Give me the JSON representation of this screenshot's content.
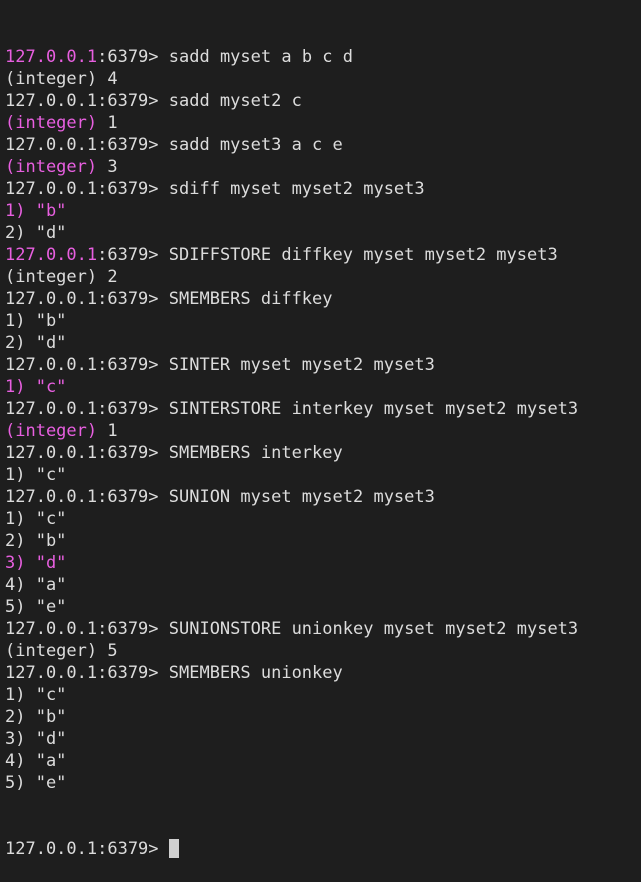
{
  "terminal": {
    "prompt": "127.0.0.1:6379> ",
    "accent_color": "#e85fe0",
    "lines": [
      {
        "parts": [
          {
            "t": "127.0.0.1",
            "c": "m"
          },
          {
            "t": ":6379> sadd myset a b c d"
          }
        ]
      },
      {
        "parts": [
          {
            "t": "(integer) 4"
          }
        ]
      },
      {
        "parts": [
          {
            "t": "127.0.0.1:6379> sadd myset2 c"
          }
        ]
      },
      {
        "parts": [
          {
            "t": "(integer) ",
            "c": "m"
          },
          {
            "t": "1"
          }
        ]
      },
      {
        "parts": [
          {
            "t": "127.0.0.1:6379> sadd myset3 a c e"
          }
        ]
      },
      {
        "parts": [
          {
            "t": "(integer) ",
            "c": "m"
          },
          {
            "t": "3"
          }
        ]
      },
      {
        "parts": [
          {
            "t": "127.0.0.1:6379> sdiff myset myset2 myset3"
          }
        ]
      },
      {
        "parts": [
          {
            "t": "1) \"b\"",
            "c": "m"
          }
        ]
      },
      {
        "parts": [
          {
            "t": "2) \"d\""
          }
        ]
      },
      {
        "parts": [
          {
            "t": "127.0.0.1",
            "c": "m"
          },
          {
            "t": ":6379> SDIFFSTORE diffkey myset myset2 myset3"
          }
        ]
      },
      {
        "parts": [
          {
            "t": "(integer) 2"
          }
        ]
      },
      {
        "parts": [
          {
            "t": "127.0.0.1:6379> SMEMBERS diffkey"
          }
        ]
      },
      {
        "parts": [
          {
            "t": "1) \"b\""
          }
        ]
      },
      {
        "parts": [
          {
            "t": "2) \"d\""
          }
        ]
      },
      {
        "parts": [
          {
            "t": "127.0.0.1:6379> SINTER myset myset2 myset3"
          }
        ]
      },
      {
        "parts": [
          {
            "t": "1) \"c\"",
            "c": "m"
          }
        ]
      },
      {
        "parts": [
          {
            "t": "127.0.0.1:6379> SINTERSTORE interkey myset myset2 myset3"
          }
        ]
      },
      {
        "parts": [
          {
            "t": "(integer) ",
            "c": "m"
          },
          {
            "t": "1"
          }
        ]
      },
      {
        "parts": [
          {
            "t": "127.0.0.1:6379> SMEMBERS interkey"
          }
        ]
      },
      {
        "parts": [
          {
            "t": "1) \"c\""
          }
        ]
      },
      {
        "parts": [
          {
            "t": "127.0.0.1:6379> SUNION myset myset2 myset3"
          }
        ]
      },
      {
        "parts": [
          {
            "t": "1) \"c\""
          }
        ]
      },
      {
        "parts": [
          {
            "t": "2) \"b\""
          }
        ]
      },
      {
        "parts": [
          {
            "t": "3) \"d\"",
            "c": "m"
          }
        ]
      },
      {
        "parts": [
          {
            "t": "4) \"a\""
          }
        ]
      },
      {
        "parts": [
          {
            "t": "5) \"e\""
          }
        ]
      },
      {
        "parts": [
          {
            "t": "127.0.0.1:6379> SUNIONSTORE unionkey myset myset2 myset3"
          }
        ]
      },
      {
        "parts": [
          {
            "t": "(integer) 5"
          }
        ]
      },
      {
        "parts": [
          {
            "t": "127.0.0.1:6379> SMEMBERS unionkey"
          }
        ]
      },
      {
        "parts": [
          {
            "t": "1) \"c\""
          }
        ]
      },
      {
        "parts": [
          {
            "t": "2) \"b\""
          }
        ]
      },
      {
        "parts": [
          {
            "t": "3) \"d\""
          }
        ]
      },
      {
        "parts": [
          {
            "t": "4) \"a\""
          }
        ]
      },
      {
        "parts": [
          {
            "t": "5) \"e\""
          }
        ]
      }
    ],
    "input_line": {
      "prompt": "127.0.0.1:6379> ",
      "value": ""
    }
  }
}
